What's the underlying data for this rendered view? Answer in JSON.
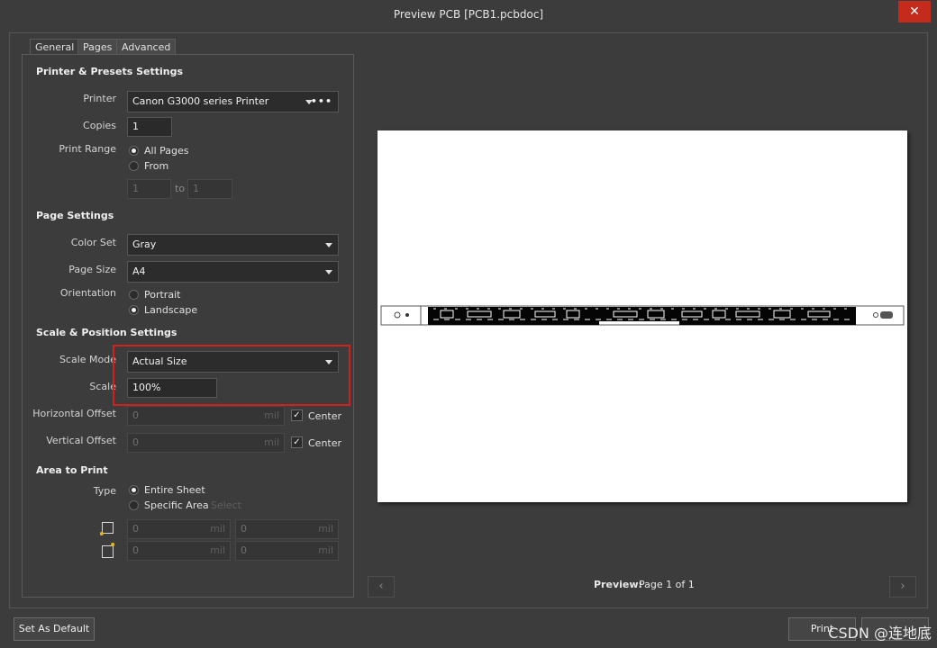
{
  "window": {
    "title": "Preview PCB [PCB1.pcbdoc]",
    "close_glyph": "✕"
  },
  "tabs": [
    "General",
    "Pages",
    "Advanced"
  ],
  "printer_presets": {
    "heading": "Printer & Presets Settings",
    "printer_label": "Printer",
    "printer_value": "Canon G3000 series Printer",
    "more_glyph": "•••",
    "copies_label": "Copies",
    "copies_value": "1",
    "print_range_label": "Print Range",
    "range_all": "All Pages",
    "range_from": "From",
    "range_from_value": "1",
    "range_to_label": "to",
    "range_to_value": "1"
  },
  "page_settings": {
    "heading": "Page Settings",
    "color_set_label": "Color Set",
    "color_set_value": "Gray",
    "page_size_label": "Page Size",
    "page_size_value": "A4",
    "orientation_label": "Orientation",
    "portrait": "Portrait",
    "landscape": "Landscape"
  },
  "scale_position": {
    "heading": "Scale & Position Settings",
    "scale_mode_label": "Scale Mode",
    "scale_mode_value": "Actual Size",
    "scale_label": "Scale",
    "scale_value": "100%",
    "h_offset_label": "Horizontal Offset",
    "h_offset_value": "0",
    "v_offset_label": "Vertical Offset",
    "v_offset_value": "0",
    "unit": "mil",
    "center_label": "Center"
  },
  "area_to_print": {
    "heading": "Area to Print",
    "type_label": "Type",
    "entire_sheet": "Entire Sheet",
    "specific_area": "Specific Area",
    "select_link": "Select",
    "x1": "0",
    "y1": "0",
    "x2": "0",
    "y2": "0",
    "unit": "mil"
  },
  "preview": {
    "label": "Preview:",
    "page_info": "Page 1 of 1",
    "prev_glyph": "‹",
    "next_glyph": "›"
  },
  "buttons": {
    "set_as_default": "Set As Default",
    "print": "Print"
  },
  "watermark": "CSDN @连地底",
  "colors": {
    "accent_red": "#d22020",
    "close_red": "#c42b1c",
    "background": "#3c3c3c"
  }
}
